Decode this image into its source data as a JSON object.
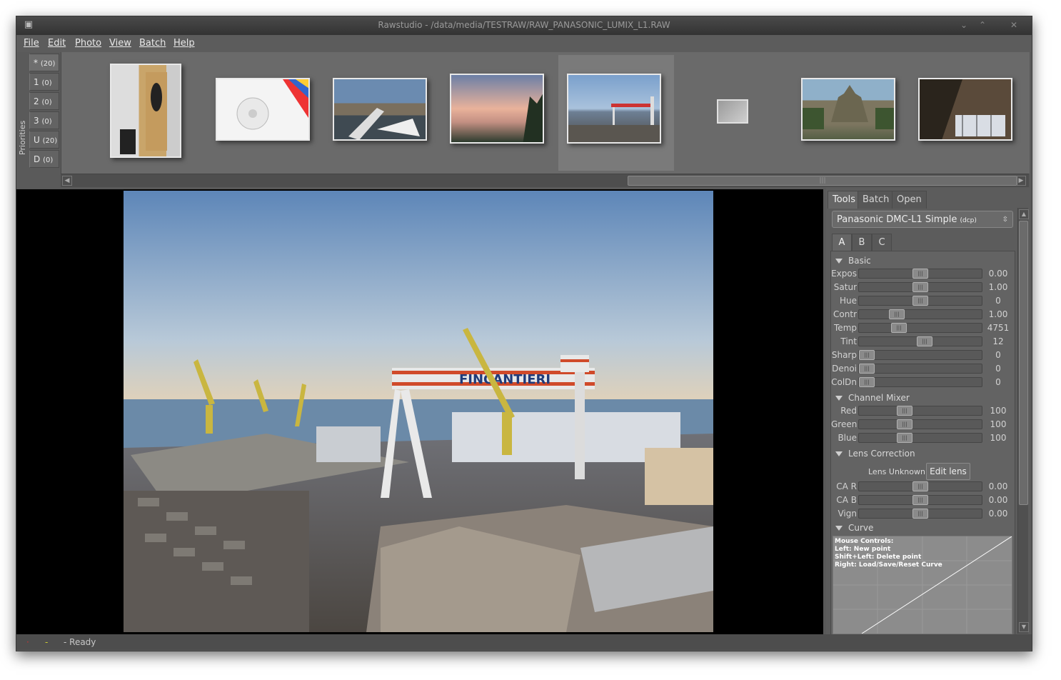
{
  "window": {
    "title": "Rawstudio - /data/media/TESTRAW/RAW_PANASONIC_LUMIX_L1.RAW"
  },
  "menu": [
    "File",
    "Edit",
    "Photo",
    "View",
    "Batch",
    "Help"
  ],
  "priorities": {
    "label": "Priorities",
    "tabs": [
      {
        "name": "*",
        "count": "(20)"
      },
      {
        "name": "1",
        "count": "(0)"
      },
      {
        "name": "2",
        "count": "(0)"
      },
      {
        "name": "3",
        "count": "(0)"
      },
      {
        "name": "U",
        "count": "(20)"
      },
      {
        "name": "D",
        "count": "(0)"
      }
    ]
  },
  "thumbnails": [
    "speaker",
    "color-wheel",
    "boats",
    "sunset",
    "shipyard",
    "placeholder",
    "angkor-wat",
    "window"
  ],
  "panel": {
    "tabs": [
      "Tools",
      "Batch",
      "Open"
    ],
    "profile": "Panasonic DMC-L1 Simple",
    "profile_suffix": "(dcp)",
    "snapshots": [
      "A",
      "B",
      "C"
    ],
    "sections": {
      "basic": "Basic",
      "channel_mixer": "Channel Mixer",
      "lens": "Lens Correction",
      "curve": "Curve"
    },
    "basic": [
      {
        "label": "Expos",
        "value": "0.00",
        "level": 0.5
      },
      {
        "label": "Satur",
        "value": "1.00",
        "level": 0.5
      },
      {
        "label": "Hue",
        "value": "0",
        "level": 0.5
      },
      {
        "label": "Contr",
        "value": "1.00",
        "level": 0.28
      },
      {
        "label": "Temp",
        "value": "4751",
        "level": 0.3
      },
      {
        "label": "Tint",
        "value": "12",
        "level": 0.54
      },
      {
        "label": "Sharp",
        "value": "0",
        "level": 0.0
      },
      {
        "label": "Denoi",
        "value": "0",
        "level": 0.0
      },
      {
        "label": "ColDn",
        "value": "0",
        "level": 0.0
      }
    ],
    "mixer": [
      {
        "label": "Red",
        "value": "100",
        "level": 0.35
      },
      {
        "label": "Green",
        "value": "100",
        "level": 0.35
      },
      {
        "label": "Blue",
        "value": "100",
        "level": 0.35
      }
    ],
    "lens_unknown": "Lens Unknown",
    "edit_lens": "Edit lens",
    "lensrows": [
      {
        "label": "CA R",
        "value": "0.00",
        "level": 0.5
      },
      {
        "label": "CA B",
        "value": "0.00",
        "level": 0.5
      },
      {
        "label": "Vign",
        "value": "0.00",
        "level": 0.5
      }
    ],
    "curve_help": [
      "Mouse Controls:",
      "Left: New point",
      "Shift+Left: Delete point",
      "Right: Load/Save/Reset Curve"
    ]
  },
  "photo": {
    "sign": "FINCANTIERI"
  },
  "status": {
    "text": "- Ready"
  }
}
